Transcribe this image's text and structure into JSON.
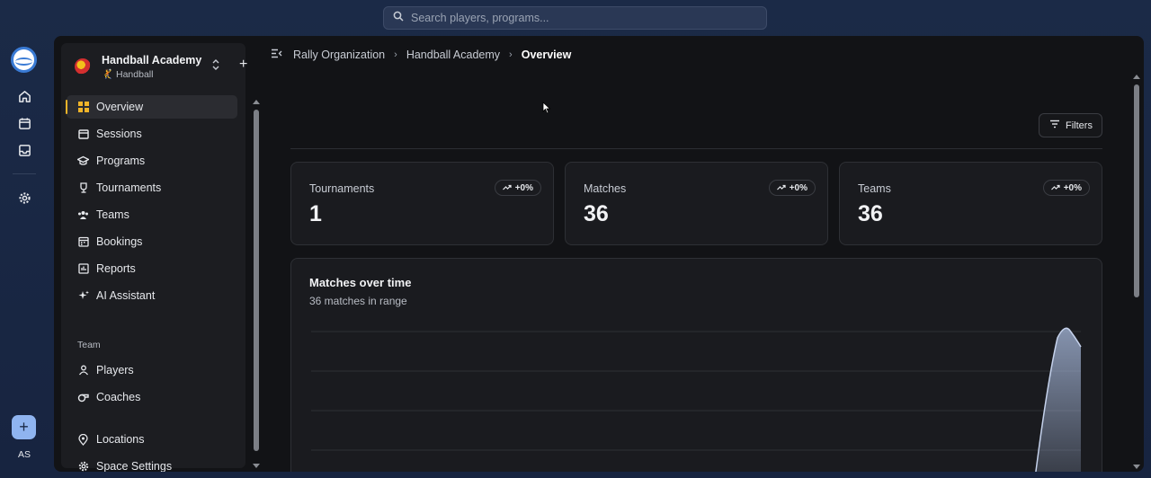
{
  "search": {
    "placeholder": "Search players, programs..."
  },
  "rail": {
    "avatar_initials": "AS"
  },
  "org": {
    "name": "Handball Academy",
    "sport": "Handball"
  },
  "nav": {
    "items": [
      {
        "label": "Overview",
        "icon": "grid-icon",
        "active": true
      },
      {
        "label": "Sessions",
        "icon": "calendar-icon"
      },
      {
        "label": "Programs",
        "icon": "graduation-icon"
      },
      {
        "label": "Tournaments",
        "icon": "trophy-icon"
      },
      {
        "label": "Teams",
        "icon": "users-icon"
      },
      {
        "label": "Bookings",
        "icon": "calendar-grid-icon"
      },
      {
        "label": "Reports",
        "icon": "report-icon"
      },
      {
        "label": "AI Assistant",
        "icon": "sparkles-icon"
      }
    ],
    "team_section_label": "Team",
    "team_items": [
      {
        "label": "Players",
        "icon": "user-icon"
      },
      {
        "label": "Coaches",
        "icon": "whistle-icon"
      }
    ],
    "bottom_items": [
      {
        "label": "Locations",
        "icon": "map-pin-icon"
      },
      {
        "label": "Space Settings",
        "icon": "gear-icon"
      }
    ]
  },
  "breadcrumb": {
    "items": [
      "Rally Organization",
      "Handball Academy"
    ],
    "current": "Overview"
  },
  "filters_label": "Filters",
  "stats": [
    {
      "title": "Tournaments",
      "value": "1",
      "change": "+0%"
    },
    {
      "title": "Matches",
      "value": "36",
      "change": "+0%"
    },
    {
      "title": "Teams",
      "value": "36",
      "change": "+0%"
    }
  ],
  "chart": {
    "title": "Matches over time",
    "subtitle": "36 matches in range"
  },
  "chart_data": {
    "type": "area",
    "title": "Matches over time",
    "subtitle": "36 matches in range",
    "grid": true,
    "series_color": "#a9bbde"
  },
  "colors": {
    "accent": "#f0b429",
    "panel": "#121316",
    "card": "#1a1b1f",
    "background": "#1b2a47"
  }
}
